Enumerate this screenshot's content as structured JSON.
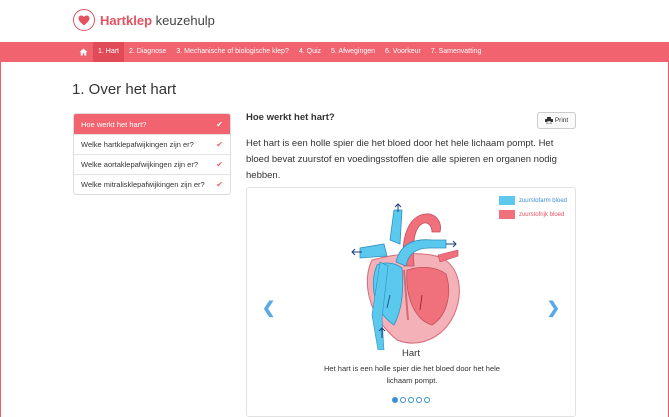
{
  "header": {
    "brand_bold": "Hartklep",
    "brand_rest": " keuzehulp"
  },
  "nav": {
    "items": [
      {
        "label": "1. Hart"
      },
      {
        "label": "2. Diagnose"
      },
      {
        "label": "3. Mechanische of biologische klep?"
      },
      {
        "label": "4. Quiz"
      },
      {
        "label": "5. Afwegingen"
      },
      {
        "label": "6. Voorkeur"
      },
      {
        "label": "7. Samenvatting"
      }
    ],
    "active_index": 0
  },
  "page": {
    "title": "1. Over het hart"
  },
  "sidebar": {
    "items": [
      {
        "label": "Hoe werkt het hart?"
      },
      {
        "label": "Welke hartklepafwijkingen zijn er?"
      },
      {
        "label": "Welke aortaklepafwijkingen zijn er?"
      },
      {
        "label": "Welke mitralisklepafwijkingen zijn er?"
      }
    ]
  },
  "content": {
    "title": "Hoe werkt het hart?",
    "print_label": "Print",
    "intro": "Het hart is een holle spier die het bloed door het hele lichaam pompt. Het bloed bevat zuurstof en voedingsstoffen die alle spieren en organen nodig hebben."
  },
  "carousel": {
    "legend": [
      {
        "label": "zuurstofarm bloed",
        "color": "#5bc8ee"
      },
      {
        "label": "zuurstofrijk bloed",
        "color": "#f0707b"
      }
    ],
    "slide_title": "Hart",
    "slide_text": "Het hart is een holle spier die het bloed door het hele lichaam pompt.",
    "slide_count": 5,
    "active_slide": 1
  },
  "colors": {
    "brand": "#f0636f",
    "accent_blue": "#3a8fd9"
  },
  "icons": {
    "logo": "heart-icon",
    "home": "home-icon",
    "check": "check-icon",
    "print": "printer-icon",
    "prev": "chevron-left-icon",
    "next": "chevron-right-icon"
  }
}
